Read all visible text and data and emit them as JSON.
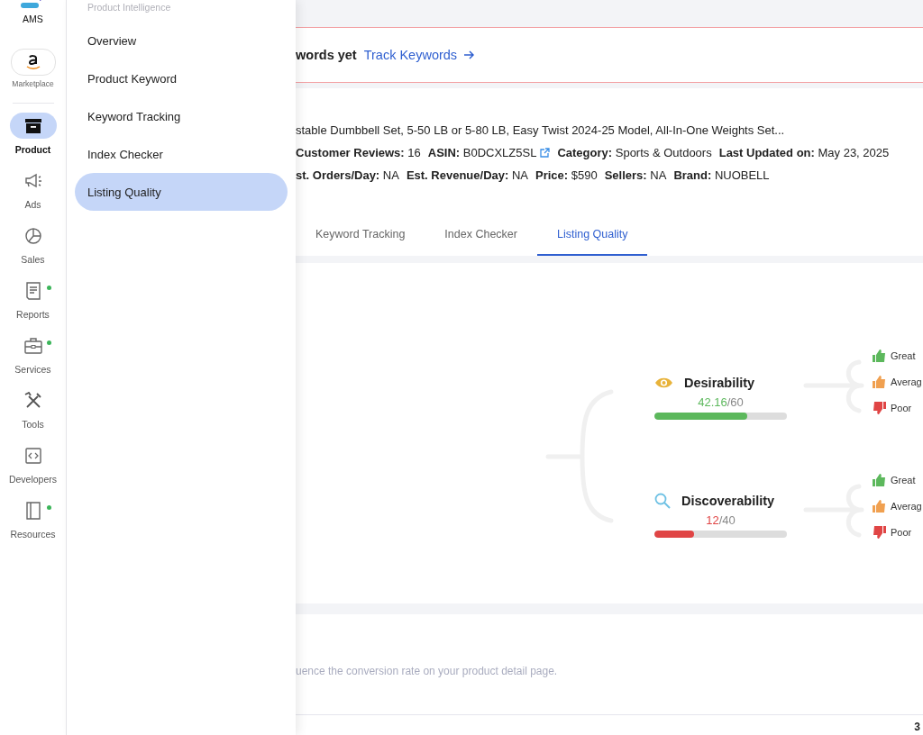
{
  "rail": {
    "items": [
      {
        "kind": "logo",
        "label": "AMS"
      },
      {
        "kind": "marketplace",
        "label": "Marketplace"
      },
      {
        "kind": "nav",
        "label": "Product",
        "selected": true,
        "dot": false
      },
      {
        "kind": "nav",
        "label": "Ads",
        "selected": false,
        "dot": false
      },
      {
        "kind": "nav",
        "label": "Sales",
        "selected": false,
        "dot": false
      },
      {
        "kind": "nav",
        "label": "Reports",
        "selected": false,
        "dot": true
      },
      {
        "kind": "nav",
        "label": "Services",
        "selected": false,
        "dot": true
      },
      {
        "kind": "nav",
        "label": "Tools",
        "selected": false,
        "dot": false
      },
      {
        "kind": "nav",
        "label": "Developers",
        "selected": false,
        "dot": false
      },
      {
        "kind": "nav",
        "label": "Resources",
        "selected": false,
        "dot": true
      }
    ]
  },
  "flyout": {
    "heading": "Product Intelligence",
    "items": [
      {
        "label": "Overview",
        "selected": false
      },
      {
        "label": "Product Keyword",
        "selected": false
      },
      {
        "label": "Keyword Tracking",
        "selected": false
      },
      {
        "label": "Index Checker",
        "selected": false
      },
      {
        "label": "Listing Quality",
        "selected": true
      }
    ]
  },
  "banner": {
    "message": "words yet",
    "link": "Track Keywords"
  },
  "product": {
    "title": "stable Dumbbell Set, 5-50 LB or 5-80 LB, Easy Twist 2024-25 Model, All-In-One Weights Set...",
    "meta_rows": [
      [
        {
          "label": "Customer Reviews:",
          "value": "16"
        },
        {
          "label": "ASIN:",
          "value": "B0DCXLZ5SL",
          "link": true
        },
        {
          "label": "Category:",
          "value": "Sports & Outdoors"
        },
        {
          "label": "Last Updated on:",
          "value": "May 23, 2025"
        }
      ],
      [
        {
          "label": "st. Orders/Day:",
          "value": "NA"
        },
        {
          "label": "Est. Revenue/Day:",
          "value": "NA"
        },
        {
          "label": "Price:",
          "value": "$590"
        },
        {
          "label": "Sellers:",
          "value": "NA"
        },
        {
          "label": "Brand:",
          "value": "NUOBELL"
        }
      ]
    ]
  },
  "tabs": [
    {
      "label": "Keyword Tracking",
      "selected": false
    },
    {
      "label": "Index Checker",
      "selected": false
    },
    {
      "label": "Listing Quality",
      "selected": true
    }
  ],
  "scores": [
    {
      "kind": "desirability",
      "title": "Desirability",
      "value": "42.16",
      "total": "/60",
      "level": 0.703,
      "color": "#5cb85c",
      "legend": [
        {
          "kind": "great",
          "label": "Great"
        },
        {
          "kind": "average",
          "label": "Averag"
        },
        {
          "kind": "poor",
          "label": "Poor"
        }
      ]
    },
    {
      "kind": "discoverability",
      "title": "Discoverability",
      "value": "12",
      "total": "/40",
      "level": 0.3,
      "color": "#e04545",
      "legend": [
        {
          "kind": "great",
          "label": "Great"
        },
        {
          "kind": "average",
          "label": "Averag"
        },
        {
          "kind": "poor",
          "label": "Poor"
        }
      ]
    }
  ],
  "footer": {
    "description": "uence the conversion rate on your product detail page.",
    "column_1": "3"
  }
}
